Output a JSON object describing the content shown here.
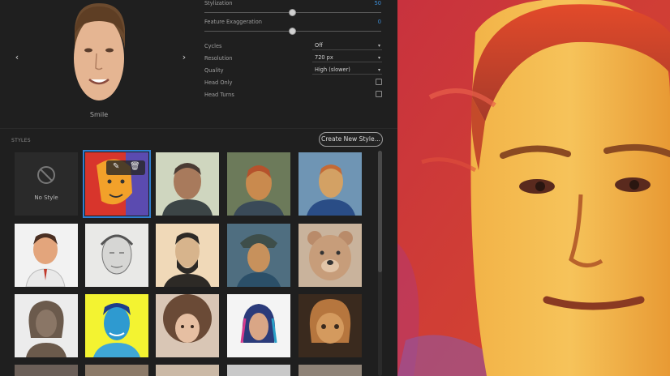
{
  "sidebar": {
    "face": {
      "caption": "Smile",
      "prev_icon": "chevron-left-icon",
      "next_icon": "chevron-right-icon"
    },
    "controls": {
      "stylization": {
        "label": "Stylization",
        "value": "50",
        "level": 0.5
      },
      "feature_exaggeration": {
        "label": "Feature Exaggeration",
        "value": "0",
        "level": 0.5
      },
      "cycles": {
        "label": "Cycles",
        "value": "Off"
      },
      "resolution": {
        "label": "Resolution",
        "value": "720 px"
      },
      "quality": {
        "label": "Quality",
        "value": "High (slower)"
      },
      "head_only": {
        "label": "Head Only",
        "checked": false
      },
      "head_turns": {
        "label": "Head Turns",
        "checked": false
      }
    },
    "styles": {
      "heading": "STYLES",
      "create_button": "Create New Style...",
      "no_style_label": "No Style",
      "selected_index": 1,
      "edit_icon": "pencil-icon",
      "delete_icon": "trash-icon",
      "items": [
        {
          "name": "no-style"
        },
        {
          "name": "red-cartoon-portrait"
        },
        {
          "name": "old-man-painting"
        },
        {
          "name": "van-gogh-portrait-1"
        },
        {
          "name": "van-gogh-portrait-2"
        },
        {
          "name": "cartoon-3d-man"
        },
        {
          "name": "pencil-sketch-man"
        },
        {
          "name": "lincoln-engraving"
        },
        {
          "name": "van-gogh-hat"
        },
        {
          "name": "bear-sculpture"
        },
        {
          "name": "bronze-bust"
        },
        {
          "name": "pop-art-man"
        },
        {
          "name": "curly-girl-sketch"
        },
        {
          "name": "watercolor-woman"
        },
        {
          "name": "wooden-figure"
        }
      ]
    }
  },
  "colors": {
    "accent": "#2f7fd0",
    "panel": "#1f1f1f",
    "value_blue": "#3e8fd9"
  }
}
